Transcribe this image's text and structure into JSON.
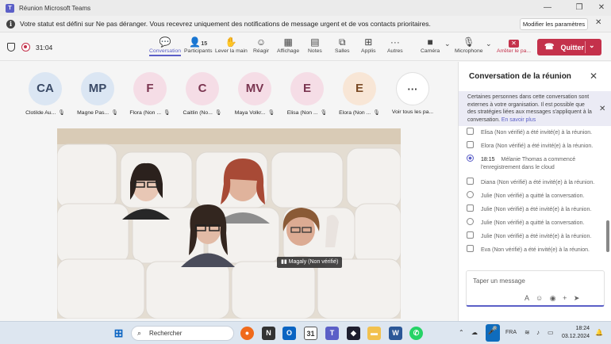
{
  "window": {
    "title": "Réunion Microsoft Teams",
    "icon": "teams-icon"
  },
  "banner": {
    "message": "Votre statut est défini sur Ne pas déranger. Vous recevrez uniquement des notifications de message urgent et de vos contacts prioritaires.",
    "button": "Modifier les paramètres"
  },
  "toolbar": {
    "timer": "31:04",
    "items": [
      {
        "label": "Conversation",
        "icon": "chat-icon",
        "active": true
      },
      {
        "label": "Participants",
        "icon": "people-icon",
        "count": "15"
      },
      {
        "label": "Lever la main",
        "icon": "raise-hand-icon"
      },
      {
        "label": "Réagir",
        "icon": "smiley-icon"
      },
      {
        "label": "Affichage",
        "icon": "view-icon"
      },
      {
        "label": "Notes",
        "icon": "notes-icon"
      },
      {
        "label": "Salles",
        "icon": "rooms-icon"
      },
      {
        "label": "Applis",
        "icon": "apps-icon"
      },
      {
        "label": "Autres",
        "icon": "more-icon"
      },
      {
        "label": "Caméra",
        "icon": "camera-icon"
      },
      {
        "label": "Microphone",
        "icon": "mic-icon"
      },
      {
        "label": "Arrêter le pa...",
        "icon": "stop-share-icon"
      }
    ],
    "leave": "Quitter"
  },
  "participants": [
    {
      "initials": "CA",
      "name": "Clotilde Au...",
      "bg": "#dbe6f3",
      "fg": "#3a4a66"
    },
    {
      "initials": "MP",
      "name": "Magne Pas...",
      "bg": "#dbe6f3",
      "fg": "#3a4a66"
    },
    {
      "initials": "F",
      "name": "Flora (Non ...",
      "bg": "#f5dde6",
      "fg": "#7a3550"
    },
    {
      "initials": "C",
      "name": "Caitlin (No...",
      "bg": "#f5dde6",
      "fg": "#7a3550"
    },
    {
      "initials": "MV",
      "name": "Maya Volkr...",
      "bg": "#f5dde6",
      "fg": "#7a3550"
    },
    {
      "initials": "E",
      "name": "Elisa (Non ...",
      "bg": "#f5dde6",
      "fg": "#7a3550"
    },
    {
      "initials": "E",
      "name": "Elora (Non ...",
      "bg": "#f8e6d6",
      "fg": "#7a4a25"
    }
  ],
  "see_all": "Voir tous les pa...",
  "video_label": "Magaly (Non vérifié)",
  "chat": {
    "title": "Conversation de la réunion",
    "notice": "Certaines personnes dans cette conversation sont externes à votre organisation. Il est possible que des stratégies liées aux messages s'appliquent à la conversation.",
    "notice_link": "En savoir plus",
    "events": [
      {
        "text": "Elisa (Non vérifié) a été invité(e) à la réunion."
      },
      {
        "text": "Elora (Non vérifié) a été invité(e) à la réunion."
      },
      {
        "time": "18:15",
        "text": "Mélanie Thomas a commencé",
        "text2": "l'enregistrement dans le cloud"
      },
      {
        "text": "Diana (Non vérifié) a été invité(e) à la réunion."
      },
      {
        "text": "Julie (Non vérifié) a quitté la conversation."
      },
      {
        "text": "Julie (Non vérifié) a été invité(e) à la réunion."
      },
      {
        "text": "Julie (Non vérifié) a quitté la conversation."
      },
      {
        "text": "Julie (Non vérifié) a été invité(e) à la réunion."
      },
      {
        "text": "Eva (Non vérifié) a été invité(e) à la réunion."
      }
    ],
    "compose_placeholder": "Taper un message"
  },
  "taskbar": {
    "search": "Rechercher",
    "lang": "FRA",
    "time": "18:24",
    "date": "03.12.2024"
  }
}
